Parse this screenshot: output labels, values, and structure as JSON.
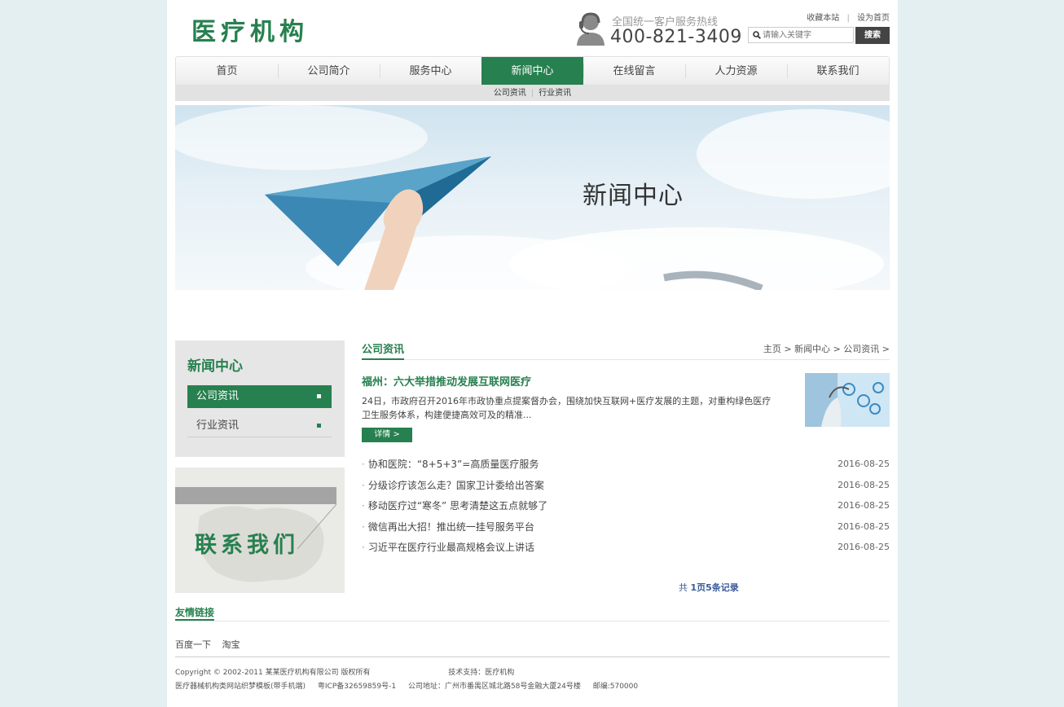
{
  "header": {
    "logo": "医疗机构",
    "hotline_label": "全国统一客户服务热线",
    "hotline_number": "400-821-3409",
    "bookmark": "收藏本站",
    "separator": "|",
    "set_home": "设为首页",
    "search_placeholder": "请输入关键字",
    "search_button": "搜索"
  },
  "nav": {
    "items": [
      {
        "label": "首页"
      },
      {
        "label": "公司简介"
      },
      {
        "label": "服务中心"
      },
      {
        "label": "新闻中心"
      },
      {
        "label": "在线留言"
      },
      {
        "label": "人力资源"
      },
      {
        "label": "联系我们"
      }
    ],
    "active_index": 3,
    "subnav": [
      "公司资讯",
      "行业资讯"
    ]
  },
  "banner": {
    "title": "新闻中心"
  },
  "sidebar": {
    "title": "新闻中心",
    "items": [
      {
        "label": "公司资讯"
      },
      {
        "label": "行业资讯"
      }
    ],
    "contact_text": "联系我们"
  },
  "main": {
    "section_title": "公司资讯",
    "breadcrumb": [
      "主页",
      ">",
      "新闻中心",
      ">",
      "公司资讯",
      ">"
    ],
    "featured": {
      "title": "福州：六大举措推动发展互联网医疗",
      "summary": "24日，市政府召开2016年市政协重点提案督办会，围绕加快互联网+医疗发展的主题，对重构绿色医疗卫生服务体系，构建便捷高效可及的精准...",
      "button": "详情 >"
    },
    "news": [
      {
        "title": "协和医院：“8+5+3”=高质量医疗服务",
        "date": "2016-08-25"
      },
      {
        "title": "分级诊疗该怎么走？国家卫计委给出答案",
        "date": "2016-08-25"
      },
      {
        "title": "移动医疗过“寒冬” 思考清楚这五点就够了",
        "date": "2016-08-25"
      },
      {
        "title": "微信再出大招！推出统一挂号服务平台",
        "date": "2016-08-25"
      },
      {
        "title": "习近平在医疗行业最高规格会议上讲话",
        "date": "2016-08-25"
      }
    ],
    "pager": {
      "prefix": "共",
      "text": "1页5条记录"
    }
  },
  "links": {
    "title": "友情链接",
    "items": [
      "百度一下",
      "淘宝"
    ]
  },
  "footer": {
    "copyright": "Copyright © 2002-2011 某某医疗机构有限公司 版权所有",
    "support": "技术支持：医疗机构",
    "template": "医疗器械机构类网站织梦模板(带手机端)",
    "icp": "粤ICP备32659859号-1",
    "address": "公司地址：广州市番禺区城北路58号金融大厦24号楼",
    "postcode": "邮编:570000"
  },
  "colors": {
    "accent": "#27804f",
    "background": "#e3eff1",
    "pager": "#3a5a9b"
  }
}
